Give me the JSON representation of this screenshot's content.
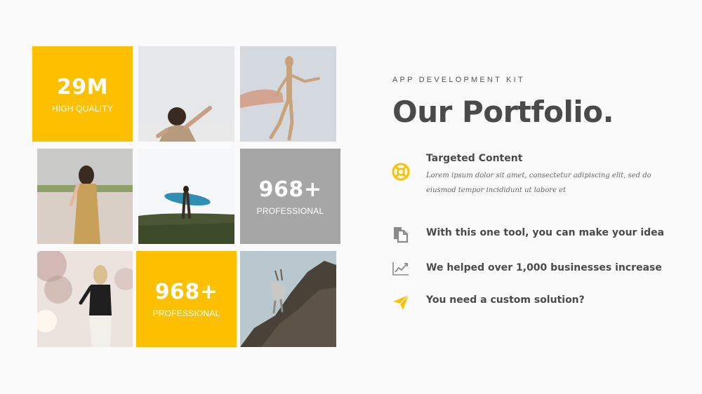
{
  "colors": {
    "accent": "#fcc000",
    "grey_tile": "#a6a6a6",
    "text": "#4a4a4a",
    "icon_grey": "#8a8a8a"
  },
  "tiles": {
    "stat1": {
      "value": "29M",
      "label": "HIGH QUALITY"
    },
    "stat2": {
      "value": "968+",
      "label": "PROFESSIONAL"
    },
    "stat3": {
      "value": "968+",
      "label": "PROFESSIONAL"
    }
  },
  "header": {
    "kicker": "APP DEVELOPMENT KIT",
    "title": "Our Portfolio."
  },
  "features": [
    {
      "icon": "lifebuoy-icon",
      "title": "Targeted Content",
      "desc": "Lorem ipsum dolor sit amet, consectetur adipiscing elit, sed do eiusmod tempor incididunt ut labore et"
    },
    {
      "icon": "documents-icon",
      "title": "With this one tool, you can make your idea"
    },
    {
      "icon": "line-chart-icon",
      "title": "We helped over 1,000 businesses increase"
    },
    {
      "icon": "paper-plane-icon",
      "title": "You need a custom solution?"
    }
  ]
}
